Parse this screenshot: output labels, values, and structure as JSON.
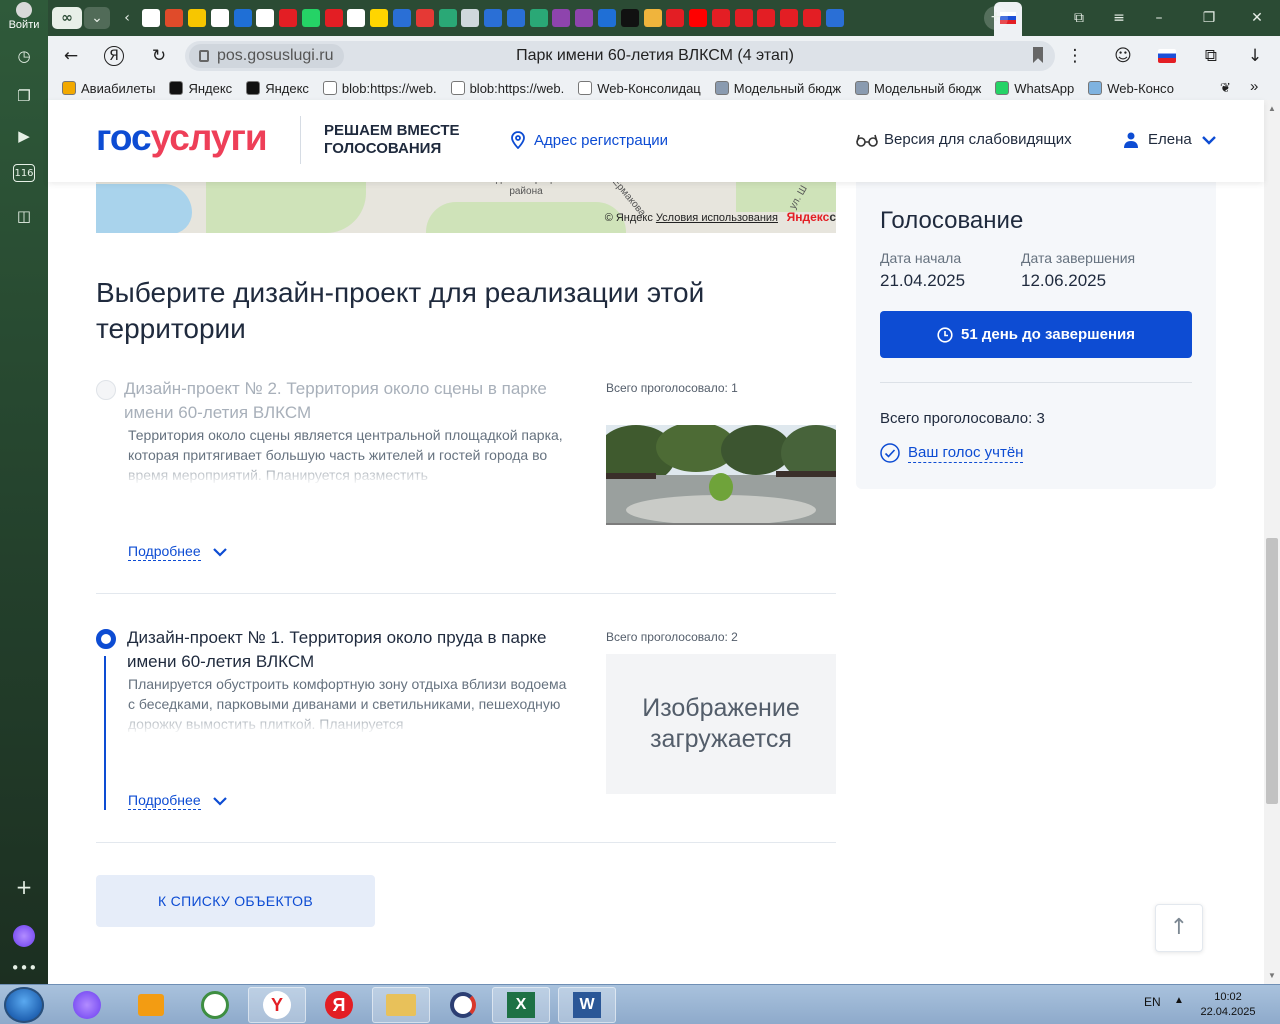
{
  "browser": {
    "login_label": "Войти",
    "domain": "pos.gosuslugi.ru",
    "tab_title": "Парк имени 60-летия ВЛКСМ (4 этап)",
    "bookmarks": [
      {
        "label": "Авиабилеты",
        "color": "#f2a900"
      },
      {
        "label": "Яндекс",
        "color": "#111111"
      },
      {
        "label": "Яндекс",
        "color": "#111111"
      },
      {
        "label": "blob:https://web.",
        "color": "#ffffff"
      },
      {
        "label": "blob:https://web.",
        "color": "#ffffff"
      },
      {
        "label": "Web-Консолидац",
        "color": "#ffffff"
      },
      {
        "label": "Модельный бюдж",
        "color": "#8a9bb0"
      },
      {
        "label": "Модельный бюдж",
        "color": "#8a9bb0"
      },
      {
        "label": "WhatsApp",
        "color": "#25d366"
      },
      {
        "label": "Web-Консо",
        "color": "#7fb3e0"
      }
    ],
    "tab_favicon_colors": [
      "#ffffff",
      "#e04b2a",
      "#f7c600",
      "#ffffff",
      "#1f6fd6",
      "#ffffff",
      "#e31e24",
      "#25d366",
      "#e31e24",
      "#ffffff",
      "#ffd500",
      "#2a6fd6",
      "#e53935",
      "#2aa876",
      "#cfd8dc",
      "#2a6fd6",
      "#2a6fd6",
      "#2aa876",
      "#8e44ad",
      "#8e44ad",
      "#1f6fd6",
      "#111111",
      "#f0b43c",
      "#e31e24",
      "#ff0000",
      "#e31e24",
      "#e31e24",
      "#e31e24",
      "#e31e24",
      "#e31e24",
      "#2a6fd6"
    ]
  },
  "header": {
    "logo_part1": "гос",
    "logo_part2": "услуги",
    "slogan": "РЕШАЕМ ВМЕСТЕ ГОЛОСОВАНИЯ",
    "address_link": "Адрес регистрации",
    "vision_link": "Версия для слабовидящих",
    "user_name": "Елена"
  },
  "map": {
    "label_admin": "Администрация района",
    "label_street": "Ермакова",
    "label_street2": "ул. Ш",
    "copyright": "© Яндекс",
    "terms": "Условия использования",
    "brand1": "Яндекс",
    "brand2": "с"
  },
  "main": {
    "heading": "Выберите дизайн-проект для реализации этой территории",
    "projects": [
      {
        "title": "Дизайн-проект № 2. Территория около сцены в парке имени 60-летия ВЛКСМ",
        "description": "Территория около сцены является центральной площадкой парка, которая притягивает большую часть жителей и гостей города во время мероприятий. Планируется разместить",
        "votes": "Всего проголосовало: 1",
        "more": "Подробнее",
        "selected": false
      },
      {
        "title": "Дизайн-проект № 1. Территория около пруда в парке имени 60-летия ВЛКСМ",
        "description": "Планируется обустроить комфортную зону отдыха вблизи водоема с беседками, парковыми диванами и светильниками, пешеходную дорожку вымостить плиткой. Планируется",
        "votes": "Всего проголосовало: 2",
        "more": "Подробнее",
        "image_placeholder": "Изображение загружается",
        "selected": true
      }
    ],
    "back_button": "К СПИСКУ ОБЪЕКТОВ"
  },
  "vote_card": {
    "title": "Голосование",
    "start_label": "Дата начала",
    "start_date": "21.04.2025",
    "end_label": "Дата завершения",
    "end_date": "12.06.2025",
    "deadline_button": "51 день до завершения",
    "total_votes": "Всего проголосовало: 3",
    "vote_status": "Ваш голос учтён"
  },
  "taskbar": {
    "lang": "EN",
    "time": "10:02",
    "date": "22.04.2025"
  },
  "colors": {
    "brand_blue": "#0d4cd3",
    "brand_red": "#ee3f58",
    "browser_green": "#2b4b34"
  }
}
